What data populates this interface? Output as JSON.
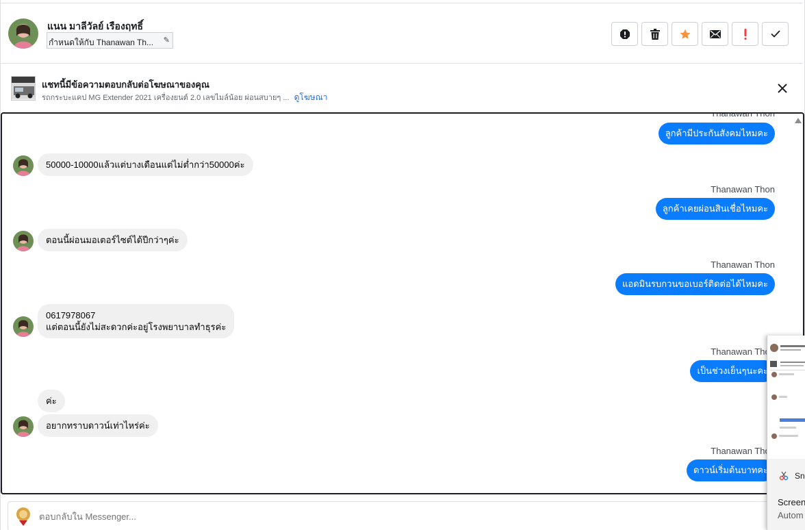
{
  "header": {
    "contact_name": "แนน มาลีวัลย์ เรืองฤทธิ์",
    "assign_label": "กำหนดให้กับ Thanawan Th...",
    "actions": [
      {
        "name": "report-icon"
      },
      {
        "name": "trash-icon"
      },
      {
        "name": "star-icon"
      },
      {
        "name": "mail-icon"
      },
      {
        "name": "exclamation-icon"
      },
      {
        "name": "check-icon"
      }
    ]
  },
  "banner": {
    "title": "แชทนี้มีข้อความตอบกลับต่อโฆษณาของคุณ",
    "subtitle": "รถกระบะแคป MG Extender 2021 เครื่องยนต์ 2.0 เลขไมล์น้อย ผ่อนสบายๆ ...",
    "link": "ดูโฆษณา"
  },
  "messages": {
    "m0_sender": "Thanawan Thon",
    "m0_text": "ลูกค้ามีประกันสังคมไหมคะ",
    "m1_text": "50000-10000แล้วแต่บางเดือนแต่ไม่ต่ำกว่า50000ค่ะ",
    "m2_sender": "Thanawan Thon",
    "m2_text": "ลูกค้าเคยผ่อนสินเชื่อไหมคะ",
    "m3_text": "ตอนนี้ผ่อนมอเตอร์ไซต์ได้ปีกว่าๆค่ะ",
    "m4_sender": "Thanawan Thon",
    "m4_text": "แอดมินรบกวนขอเบอร์ติดต่อได้ไหมคะ",
    "m5_line1": "0617978067",
    "m5_line2": "แต่ตอนนี้ยังไม่สะดวกค่ะอยู่โรงพยาบาลทำธุรค่ะ",
    "m6_sender": "Thanawan Thon",
    "m6_text": "เป็นช่วงเย็นๆนะคะ",
    "m7_text": "ค่ะ",
    "m8_text": "อยากทราบดาวน์เท่าไหร่ค่ะ",
    "m9_sender": "Thanawan Thon",
    "m9_text": "ดาวน์เริ่มต้นบาทคะ"
  },
  "reply": {
    "placeholder": "ตอบกลับใน Messenger..."
  },
  "snip": {
    "app": "Snip",
    "title": "Screen",
    "subtitle": "Autom"
  },
  "colors": {
    "accent": "#0a7cff",
    "star": "#f7923b",
    "flag": "#fa383e"
  }
}
